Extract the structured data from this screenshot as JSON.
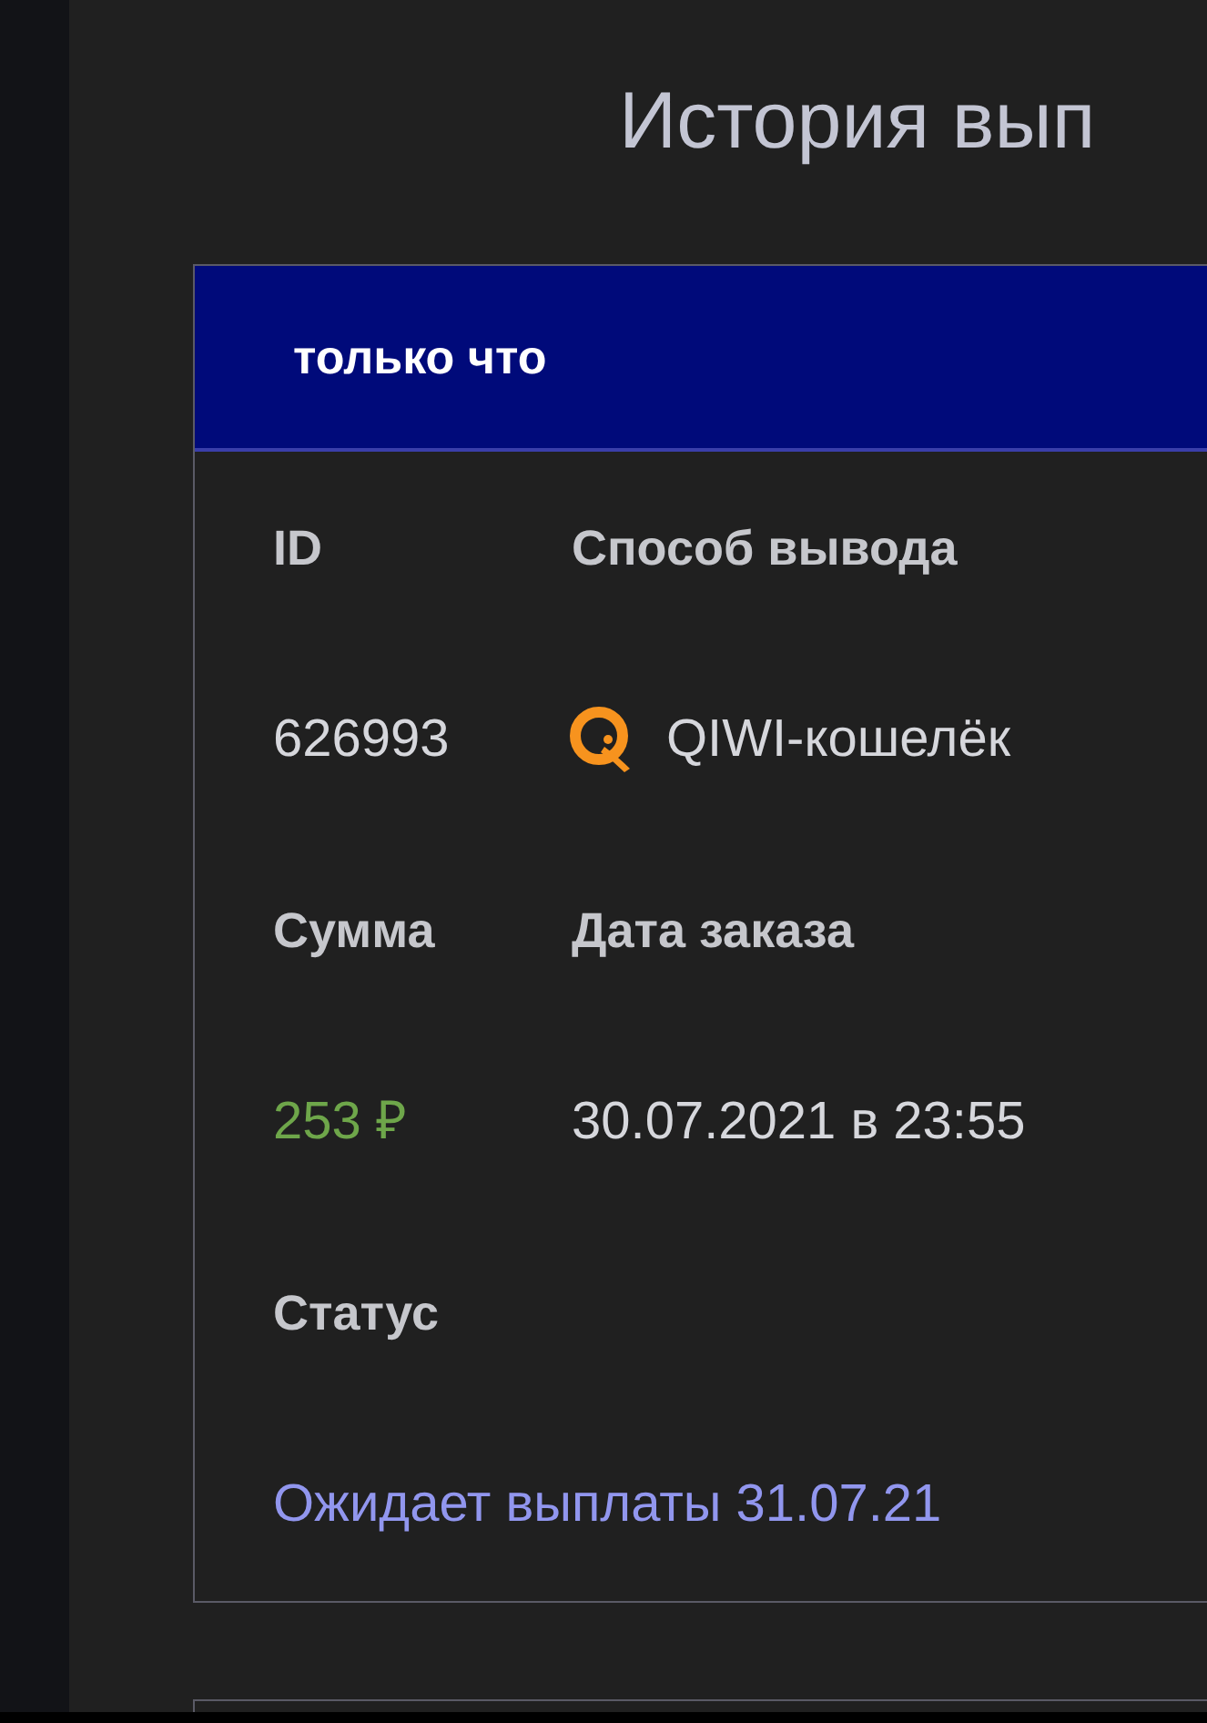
{
  "page": {
    "title": "История вып"
  },
  "payout_card": {
    "header": "только что",
    "rows": [
      [
        {
          "label": "ID",
          "value": "626993",
          "kind": "text"
        },
        {
          "label": "Способ вывода",
          "value": "QIWI-кошелёк",
          "kind": "wallet"
        }
      ],
      [
        {
          "label": "Сумма",
          "value": "253 ₽",
          "kind": "amount"
        },
        {
          "label": "Дата заказа",
          "value": "30.07.2021 в 23:55",
          "kind": "text"
        }
      ],
      [
        {
          "label": "Статус",
          "value": "Ожидает выплаты 31.07.21",
          "kind": "status"
        }
      ]
    ]
  }
}
